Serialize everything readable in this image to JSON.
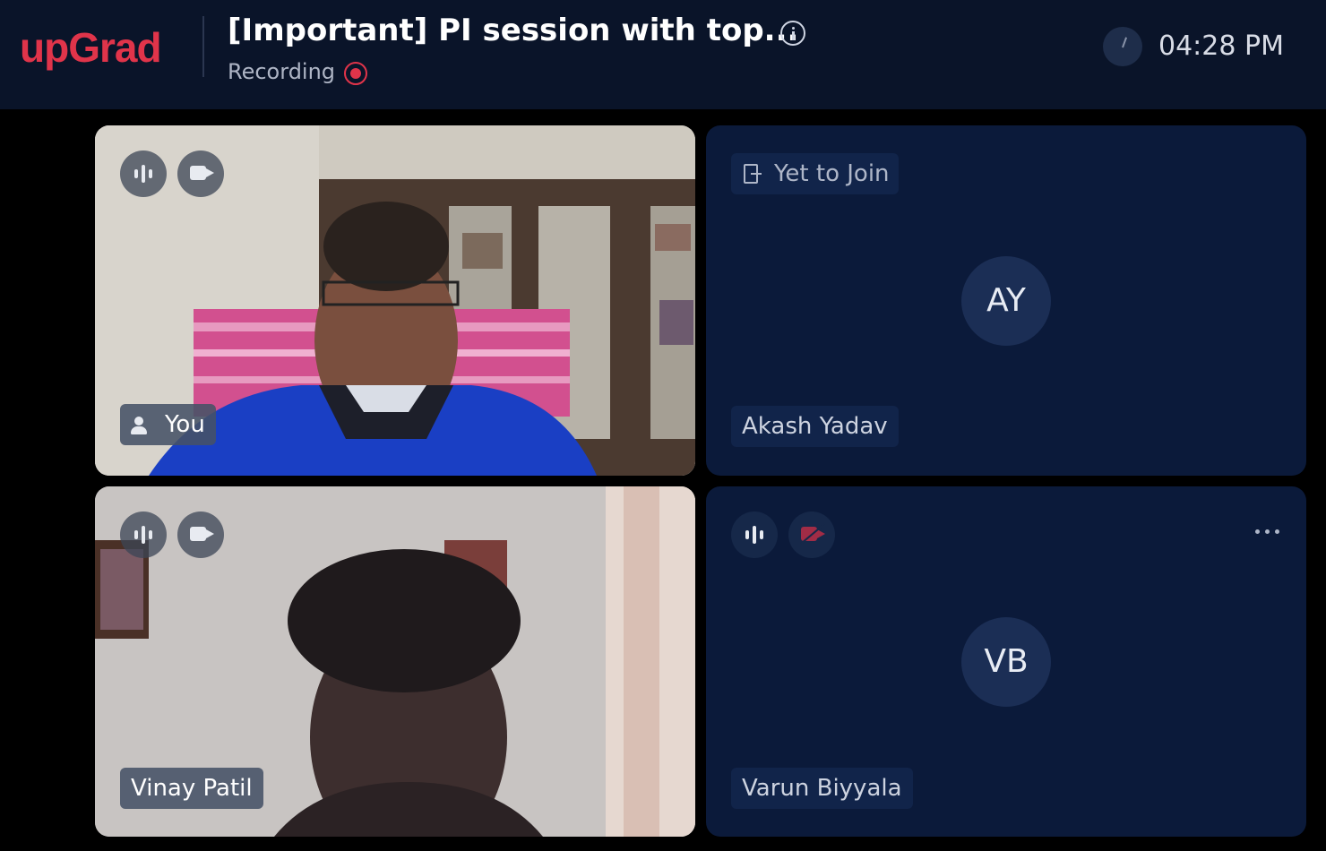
{
  "header": {
    "logo": "upGrad",
    "title": "[Important] PI session with top...",
    "recording_label": "Recording",
    "time": "04:28 PM"
  },
  "tiles": [
    {
      "type": "video",
      "name": "You"
    },
    {
      "type": "avatar",
      "status": "Yet to Join",
      "initials": "AY",
      "name": "Akash Yadav"
    },
    {
      "type": "video",
      "name": "Vinay Patil"
    },
    {
      "type": "avatar",
      "initials": "VB",
      "name": "Varun Biyyala",
      "camera": "off"
    }
  ],
  "colors": {
    "brand": "#e0344a",
    "header_bg": "#0a1429",
    "tile_bg": "#0b1a3a"
  }
}
